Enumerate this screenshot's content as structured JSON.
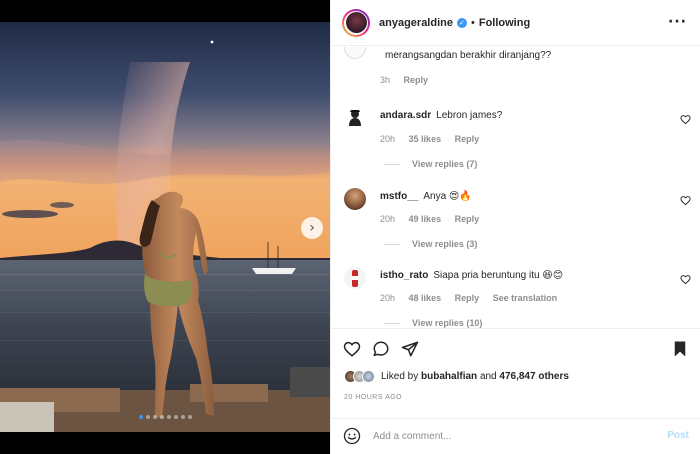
{
  "header": {
    "username": "anyageraldine",
    "separator": "•",
    "follow_state": "Following",
    "more_glyph": "···",
    "verified_glyph": "✓"
  },
  "media": {
    "next_glyph": "›",
    "slide_count": 8,
    "active_slide": 1
  },
  "comments": [
    {
      "id": "c0",
      "username": "",
      "text": "merangsangdan berakhir diranjang??",
      "time": "3h",
      "likes": "",
      "reply": "Reply",
      "see_translation": "",
      "view_replies": ""
    },
    {
      "id": "c1",
      "username": "andara.sdr",
      "text": "Lebron james?",
      "time": "20h",
      "likes": "35 likes",
      "reply": "Reply",
      "see_translation": "",
      "view_replies": "View replies (7)"
    },
    {
      "id": "c2",
      "username": "mstfo__",
      "text": "Anya 😍🔥",
      "time": "20h",
      "likes": "49 likes",
      "reply": "Reply",
      "see_translation": "",
      "view_replies": "View replies (3)"
    },
    {
      "id": "c3",
      "username": "istho_rato",
      "text": "Siapa pria beruntung itu 😆😊",
      "time": "20h",
      "likes": "48 likes",
      "reply": "Reply",
      "see_translation": "See translation",
      "view_replies": "View replies (10)"
    }
  ],
  "likes": {
    "prefix": "Liked by",
    "user": "bubahalfian",
    "and": "and",
    "count": "476,847 others"
  },
  "timestamp": "20 HOURS AGO",
  "composer": {
    "placeholder": "Add a comment...",
    "post_label": "Post"
  },
  "icons": {
    "like": "heart-icon",
    "comment": "comment-icon",
    "share": "send-icon",
    "save": "bookmark-icon",
    "emoji": "emoji-icon",
    "more": "more-icon",
    "verified": "verified-badge-icon",
    "next": "chevron-right-icon"
  },
  "colors": {
    "accent": "#3897f0",
    "muted_text": "#8e8e8e",
    "post_disabled": "#b2dffc"
  }
}
